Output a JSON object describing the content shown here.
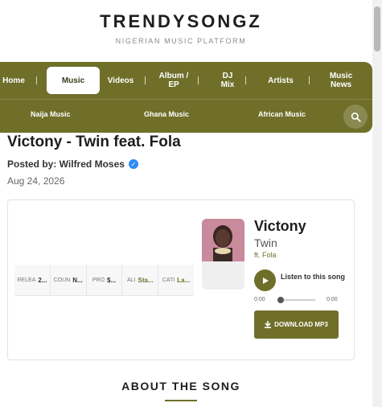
{
  "brand": {
    "logo": "TRENDYSONGZ",
    "tagline": "NIGERIAN MUSIC PLATFORM"
  },
  "nav": {
    "items": [
      {
        "label": "Home"
      },
      {
        "label": "Music"
      },
      {
        "label": "Videos"
      },
      {
        "label": "Album / EP"
      },
      {
        "label": "DJ Mix"
      },
      {
        "label": "Artists"
      },
      {
        "label": "Music News"
      }
    ],
    "sub_items": [
      {
        "label": "Naija Music"
      },
      {
        "label": "Ghana Music"
      },
      {
        "label": "African Music"
      }
    ],
    "active": "Music",
    "search_icon": "search-icon"
  },
  "post": {
    "title": "Victony - Twin feat. Fola",
    "posted_by_label": "Posted by: Wilfred Moses",
    "verified_icon": "check-badge-icon",
    "date": "Aug 24, 2026"
  },
  "info": [
    {
      "key": "RELEA",
      "value": "2..."
    },
    {
      "key": "COUN",
      "value": "N..."
    },
    {
      "key": "PRO",
      "value": "$..."
    },
    {
      "key": "ALI",
      "value": "Sta..."
    },
    {
      "key": "CATI",
      "value": "La..."
    }
  ],
  "player": {
    "artist": "Victony",
    "song": "Twin",
    "feat": "ft. Fola",
    "listen_label": "Listen to this song",
    "time_current": "0:00",
    "time_total": "0:00",
    "progress": 0,
    "download_label": "DOWNLOAD MP3"
  },
  "about": {
    "heading": "ABOUT THE SONG"
  },
  "colors": {
    "accent": "#6f6f2a",
    "verified": "#2d8cf0"
  }
}
